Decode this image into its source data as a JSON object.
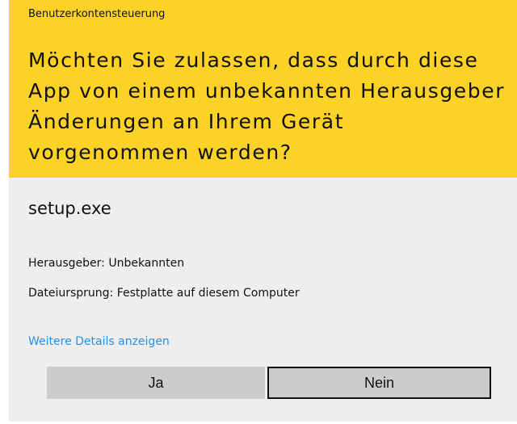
{
  "dialog": {
    "window_title": "Benutzerkontensteuerung",
    "question": "Möchten Sie zulassen, dass durch diese App von einem unbekannten Herausgeber Änderungen an Ihrem Gerät vorgenommen werden?",
    "app_name": "setup.exe",
    "publisher": "Herausgeber: Unbekannten",
    "origin": "Dateiursprung: Festplatte auf diesem Computer",
    "details_link": "Weitere Details anzeigen",
    "buttons": {
      "yes": "Ja",
      "no": "Nein"
    }
  },
  "colors": {
    "header_bg": "#fdd227",
    "body_bg": "#eeeeee",
    "link": "#2a8fe0",
    "button_bg": "#cccccc"
  }
}
